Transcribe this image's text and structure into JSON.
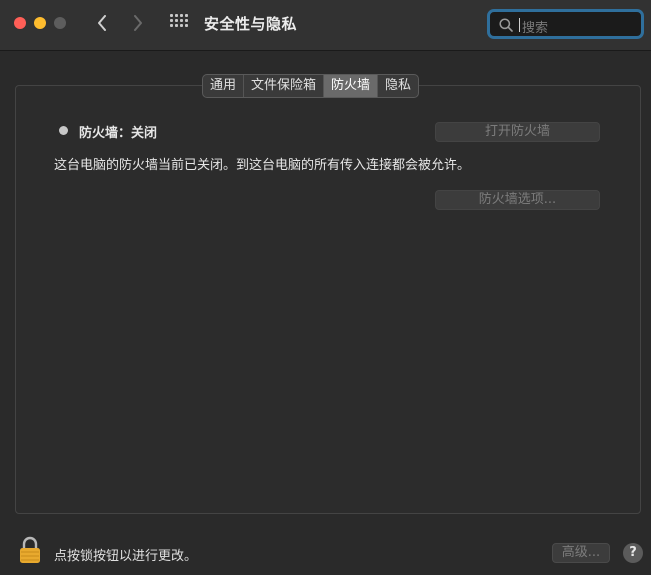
{
  "window": {
    "title": "安全性与隐私"
  },
  "search": {
    "placeholder": "搜索"
  },
  "tabs": [
    {
      "label": "通用",
      "active": false
    },
    {
      "label": "文件保险箱",
      "active": false
    },
    {
      "label": "防火墙",
      "active": true
    },
    {
      "label": "隐私",
      "active": false
    }
  ],
  "firewall": {
    "status_label": "防火墙：关闭",
    "description": "这台电脑的防火墙当前已关闭。到这台电脑的所有传入连接都会被允许。",
    "turn_on_button": "打开防火墙",
    "options_button": "防火墙选项..."
  },
  "footer": {
    "lock_text": "点按锁按钮以进行更改。",
    "advanced_button": "高级...",
    "help_button": "?"
  },
  "colors": {
    "close": "#ff5f57",
    "minimize": "#febc2e",
    "zoom_inactive": "#5d5d5d",
    "search_focus": "#2f6f9c",
    "lock": "#e8a92e"
  },
  "icons": {
    "back": "chevron-left-icon",
    "forward": "chevron-right-icon",
    "show_all": "grid-icon",
    "search": "search-icon",
    "lock": "lock-icon"
  }
}
